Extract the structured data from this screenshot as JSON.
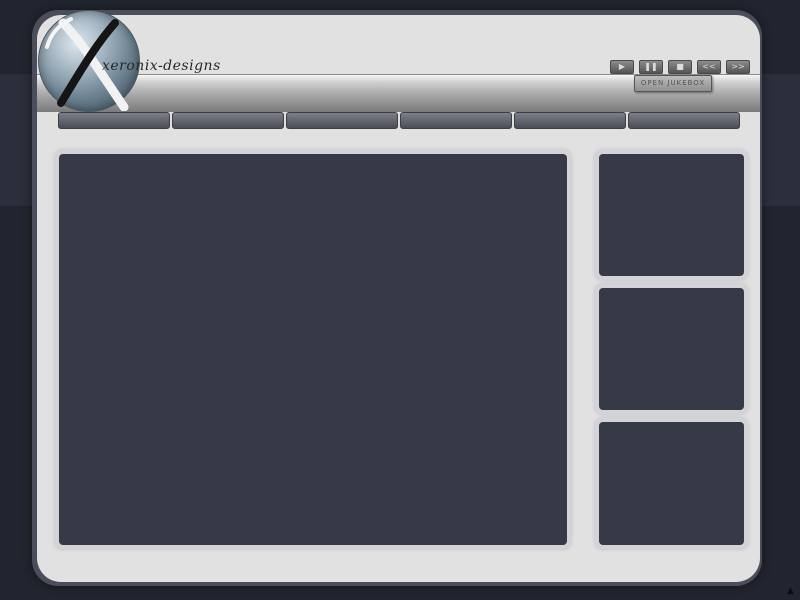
{
  "branding": {
    "logo_text": "xeronix-designs",
    "logo_icon": "x-sphere-logo-icon"
  },
  "media_controls": [
    {
      "name": "play",
      "icon": "▶"
    },
    {
      "name": "pause",
      "icon": "❚❚"
    },
    {
      "name": "stop",
      "icon": "■"
    },
    {
      "name": "previous",
      "icon": "<<"
    },
    {
      "name": "next",
      "icon": ">>"
    }
  ],
  "jukebox": {
    "label": "OPEN JUKEBOX"
  },
  "nav": {
    "items": [
      "",
      "",
      "",
      "",
      "",
      ""
    ]
  },
  "colors": {
    "background": "#22252f",
    "panel": "#e1e1e1",
    "content_box": "#363a46",
    "nav_button": "#5b5e67"
  },
  "corner_icon": "▲"
}
